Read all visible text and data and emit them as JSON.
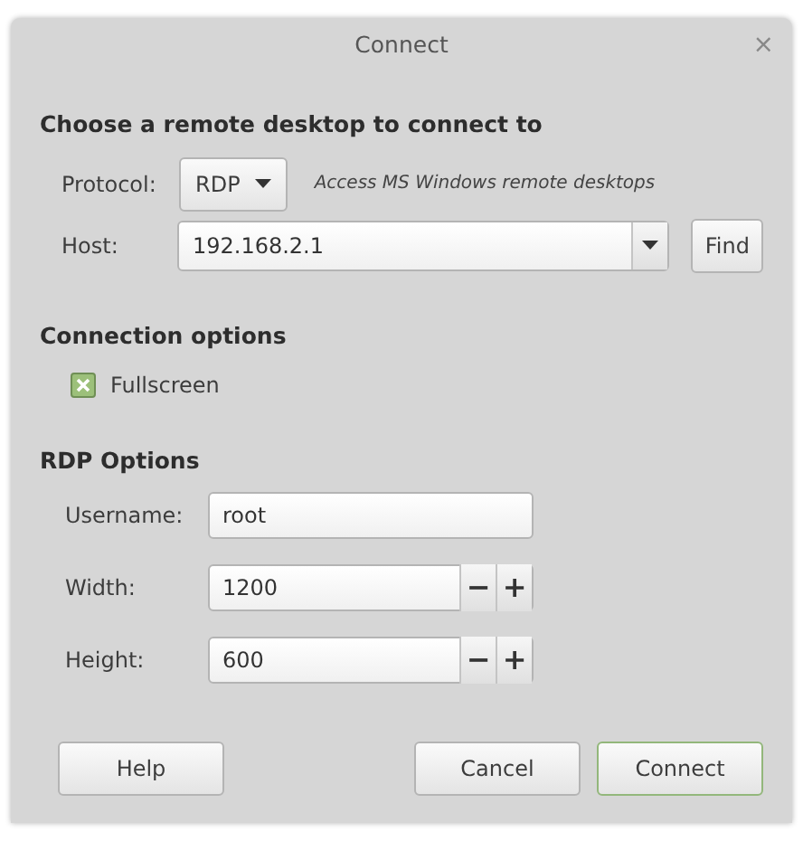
{
  "window": {
    "title": "Connect",
    "close": "×"
  },
  "heading": "Choose a remote desktop to connect to",
  "protocol": {
    "label": "Protocol:",
    "value": "RDP",
    "hint": "Access MS Windows remote desktops"
  },
  "host": {
    "label": "Host:",
    "value": "192.168.2.1",
    "button": "Find"
  },
  "connection_options": {
    "heading": "Connection options",
    "checkboxes": [
      {
        "label": "Fullscreen",
        "checked": true
      }
    ]
  },
  "rdp_options": {
    "heading": "RDP Options",
    "fields": [
      {
        "kind": "text",
        "label": "Username:",
        "value": "root"
      },
      {
        "kind": "spin",
        "label": "Width:",
        "value": "1200",
        "minus": "−",
        "plus": "+"
      },
      {
        "kind": "spin",
        "label": "Height:",
        "value": "600",
        "minus": "−",
        "plus": "+"
      }
    ]
  },
  "buttons": [
    {
      "label": "Help",
      "default": false
    },
    {
      "label": "Cancel",
      "default": false
    },
    {
      "label": "Connect",
      "default": true
    }
  ]
}
